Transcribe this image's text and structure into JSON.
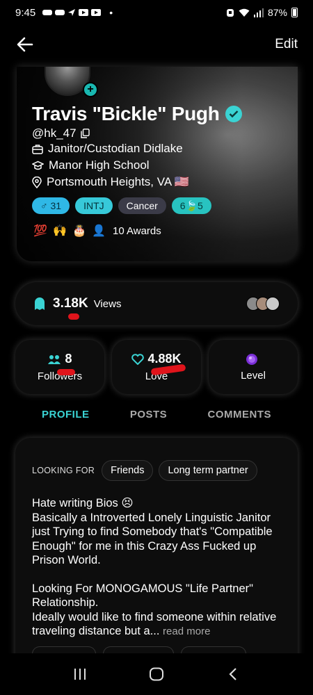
{
  "status_bar": {
    "time": "9:45",
    "battery": "87%"
  },
  "header": {
    "edit_label": "Edit"
  },
  "profile": {
    "name": "Travis \"Bickle\" Pugh",
    "handle": "@hk_47",
    "job": "Janitor/Custodian Didlake",
    "school": "Manor High School",
    "location": "Portsmouth Heights, VA 🇺🇸",
    "tags": {
      "gender_age": "31",
      "mbti": "INTJ",
      "zodiac": "Cancer",
      "extra": "6🍃5"
    },
    "awards_label": "10 Awards",
    "award_icons": [
      "💯",
      "🙌",
      "🎂",
      "👤"
    ]
  },
  "views": {
    "count": "3.18K",
    "label": "Views"
  },
  "stats": [
    {
      "value": "8",
      "label": "Followers"
    },
    {
      "value": "4.88K",
      "label": "Love"
    },
    {
      "value": "",
      "label": "Level"
    }
  ],
  "tabs": [
    "PROFILE",
    "POSTS",
    "COMMENTS"
  ],
  "about": {
    "looking_for_label": "LOOKING FOR",
    "looking_for": [
      "Friends",
      "Long term partner"
    ],
    "bio_p1": "Hate writing Bios 😣\nBasically a Introverted Lonely Linguistic Janitor just Trying to find Somebody that's \"Compatible Enough\" for me in this Crazy Ass Fucked up Prison World.",
    "bio_p2": "Looking For MONOGAMOUS \"Life Partner\" Relationship.\nIdeally would like to find someone within relative traveling distance but a...",
    "read_more": "read more"
  },
  "colors": {
    "accent": "#3ad3d3",
    "red_mark": "#e0141b",
    "level_gem": "#7a2fd6"
  }
}
